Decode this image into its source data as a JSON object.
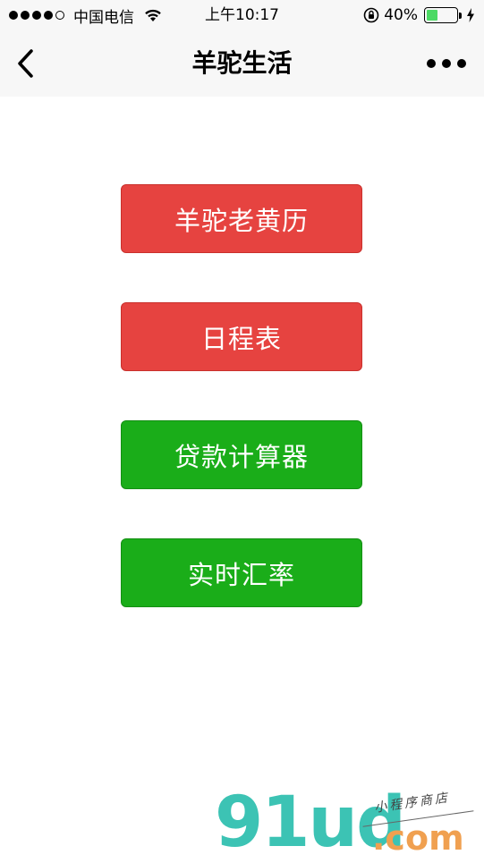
{
  "status_bar": {
    "carrier": "中国电信",
    "time": "上午10:17",
    "battery_percent": "40%",
    "battery_level": 0.4,
    "signal_bars_filled": 4,
    "signal_bars_total": 5
  },
  "nav": {
    "title": "羊驼生活",
    "back_icon": "chevron-left-icon",
    "more_icon": "more-dots-icon"
  },
  "menu": {
    "buttons": [
      {
        "label": "羊驼老黄历",
        "color": "#e64340"
      },
      {
        "label": "日程表",
        "color": "#e64340"
      },
      {
        "label": "贷款计算器",
        "color": "#1aad19"
      },
      {
        "label": "实时汇率",
        "color": "#1aad19"
      }
    ]
  },
  "watermark": {
    "brand": "91ud",
    "domain": ".com",
    "tagline": "小程序商店"
  }
}
